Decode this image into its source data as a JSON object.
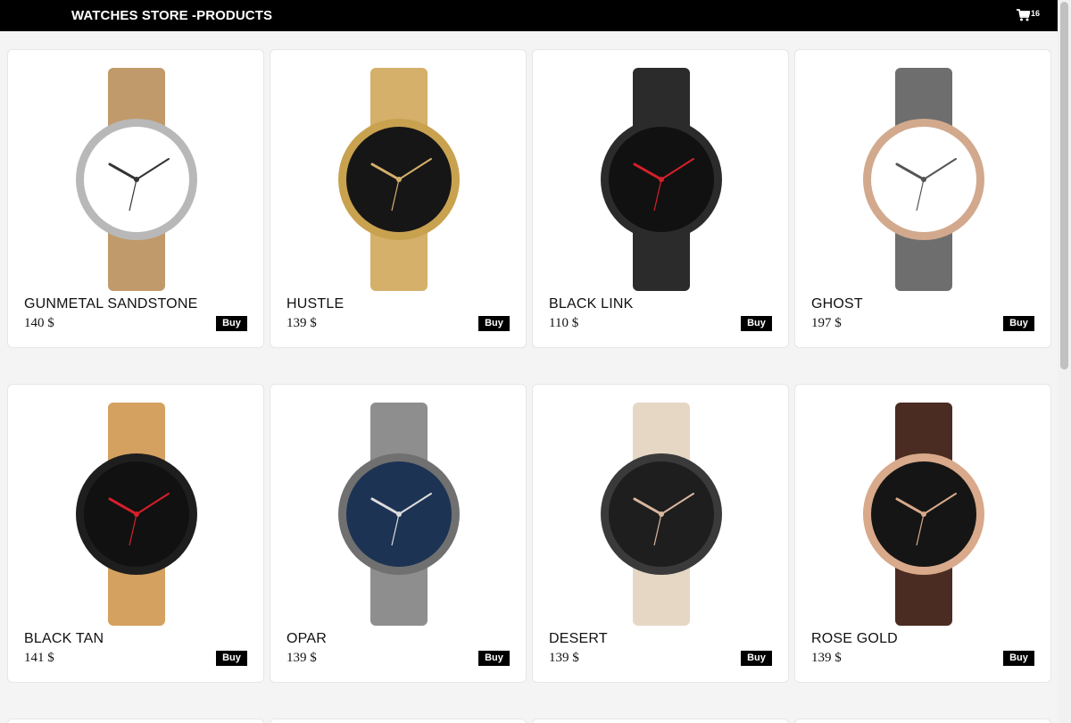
{
  "header": {
    "title": "WATCHES STORE -PRODUCTS",
    "cart_icon": "cart-icon",
    "cart_count": "16"
  },
  "products": [
    {
      "name": "GUNMETAL SANDSTONE",
      "price": "140 $",
      "buy_label": "Buy",
      "strap": "#c19a6b",
      "case": "#b8b8b8",
      "dial": "#ffffff",
      "hand": "#333333"
    },
    {
      "name": "HUSTLE",
      "price": "139 $",
      "buy_label": "Buy",
      "strap": "#d4b06a",
      "case": "#c9a24f",
      "dial": "#161616",
      "hand": "#d4b06a"
    },
    {
      "name": "BLACK LINK",
      "price": "110 $",
      "buy_label": "Buy",
      "strap": "#2b2b2b",
      "case": "#2b2b2b",
      "dial": "#111111",
      "hand": "#d6202a"
    },
    {
      "name": "GHOST",
      "price": "197 $",
      "buy_label": "Buy",
      "strap": "#6e6e6e",
      "case": "#d2a98d",
      "dial": "#ffffff",
      "hand": "#555555"
    },
    {
      "name": "BLACK TAN",
      "price": "141 $",
      "buy_label": "Buy",
      "strap": "#d4a160",
      "case": "#1e1e1e",
      "dial": "#111111",
      "hand": "#d6202a"
    },
    {
      "name": "OPAR",
      "price": "139 $",
      "buy_label": "Buy",
      "strap": "#8e8e8e",
      "case": "#707070",
      "dial": "#1d3354",
      "hand": "#dddddd"
    },
    {
      "name": "DESERT",
      "price": "139 $",
      "buy_label": "Buy",
      "strap": "#e6d7c5",
      "case": "#3a3a3a",
      "dial": "#1e1e1e",
      "hand": "#d9b7a0"
    },
    {
      "name": "ROSE GOLD",
      "price": "139 $",
      "buy_label": "Buy",
      "strap": "#4a2c22",
      "case": "#d8a98a",
      "dial": "#151515",
      "hand": "#d8a98a"
    }
  ]
}
